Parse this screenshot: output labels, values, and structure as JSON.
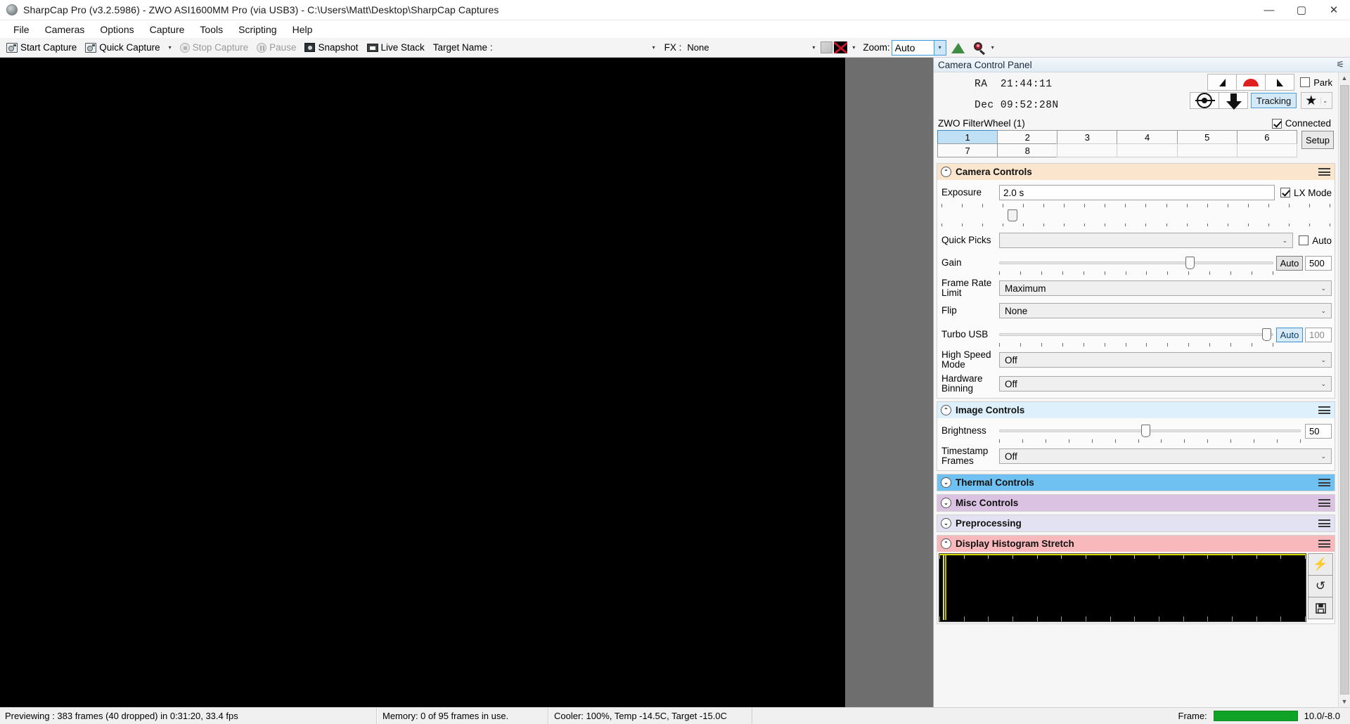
{
  "window": {
    "title": "SharpCap Pro (v3.2.5986) - ZWO ASI1600MM Pro (via USB3) - C:\\Users\\Matt\\Desktop\\SharpCap Captures",
    "minimize": "—",
    "maximize": "▢",
    "close": "✕"
  },
  "menu": {
    "items": [
      "File",
      "Cameras",
      "Options",
      "Capture",
      "Tools",
      "Scripting",
      "Help"
    ]
  },
  "toolbar": {
    "start_capture": "Start Capture",
    "quick_capture": "Quick Capture",
    "quick_capture_caret": "▾",
    "stop_capture": "Stop Capture",
    "pause": "Pause",
    "snapshot": "Snapshot",
    "live_stack": "Live Stack",
    "target_name_label": "Target Name :",
    "target_name_value": "",
    "target_caret": "▾",
    "fx_label": "FX :",
    "fx_value": "None",
    "fx_caret": "▾",
    "swatch_caret": "▾",
    "zoom_label": "Zoom:",
    "zoom_value": "Auto",
    "zoom_caret": "▾",
    "mag_caret": "▾"
  },
  "panel": {
    "title": "Camera Control Panel",
    "pin": "📌"
  },
  "mount": {
    "ra_label": "RA",
    "ra_value": "21:44:11",
    "dec_label": "Dec",
    "dec_value": "09:52:28N",
    "park_label": "Park",
    "park_checked": false,
    "tracking_label": "Tracking",
    "star_caret": "⌄"
  },
  "filterwheel": {
    "name": "ZWO FilterWheel (1)",
    "connected_label": "Connected",
    "connected": true,
    "slots": [
      "1",
      "2",
      "3",
      "4",
      "5",
      "6",
      "7",
      "8"
    ],
    "selected_slot": "1",
    "setup_label": "Setup"
  },
  "camera_controls": {
    "header": "Camera Controls",
    "collapse_icon": "⌃",
    "exposure_label": "Exposure",
    "exposure_value": "2.0 s",
    "lx_mode_label": "LX Mode",
    "lx_mode_checked": true,
    "exposure_slider_pct": 17,
    "quick_picks_label": "Quick Picks",
    "quick_picks_value": "",
    "quick_picks_auto_label": "Auto",
    "quick_picks_auto_checked": false,
    "gain_label": "Gain",
    "gain_auto_label": "Auto",
    "gain_value": "500",
    "gain_slider_pct": 68,
    "frame_rate_label": "Frame Rate Limit",
    "frame_rate_value": "Maximum",
    "flip_label": "Flip",
    "flip_value": "None",
    "turbo_usb_label": "Turbo USB",
    "turbo_usb_auto_label": "Auto",
    "turbo_usb_value": "100",
    "turbo_usb_slider_pct": 97,
    "high_speed_label": "High Speed Mode",
    "high_speed_value": "Off",
    "hardware_binning_label": "Hardware Binning",
    "hardware_binning_value": "Off"
  },
  "image_controls": {
    "header": "Image Controls",
    "collapse_icon": "⌃",
    "brightness_label": "Brightness",
    "brightness_value": "50",
    "brightness_slider_pct": 47,
    "timestamp_label": "Timestamp Frames",
    "timestamp_value": "Off"
  },
  "collapsed_sections": [
    {
      "header": "Thermal Controls",
      "icon": "⌄",
      "style": "hd-thermal"
    },
    {
      "header": "Misc Controls",
      "icon": "⌄",
      "style": "hd-misc"
    },
    {
      "header": "Preprocessing",
      "icon": "⌄",
      "style": "hd-prep"
    }
  ],
  "histogram": {
    "header": "Display Histogram Stretch",
    "collapse_icon": "⌃",
    "auto_stretch_icon": "⚡",
    "reset_icon": "↺",
    "save_icon": "💾"
  },
  "statusbar": {
    "preview_status": "Previewing : 383 frames (40 dropped) in 0:31:20, 33.4 fps",
    "memory_status": "Memory: 0 of 95 frames in use.",
    "cooler_status": "Cooler: 100%, Temp -14.5C, Target -15.0C",
    "frame_label": "Frame:",
    "frame_values": "10.0/-8.0"
  }
}
